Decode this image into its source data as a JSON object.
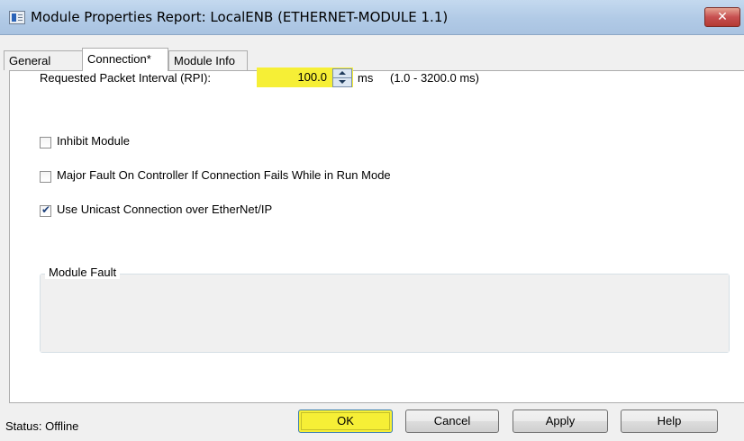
{
  "window": {
    "title": "Module Properties Report: LocalENB (ETHERNET-MODULE 1.1)",
    "close_glyph": "✕"
  },
  "tabs": [
    {
      "label": "General"
    },
    {
      "label": "Connection*",
      "active": true
    },
    {
      "label": "Module Info"
    }
  ],
  "connection": {
    "rpi_label": "Requested Packet Interval (RPI):",
    "rpi_value": "100.0",
    "rpi_unit": "ms",
    "rpi_range": "(1.0 - 3200.0 ms)",
    "highlight_color": "#f6ef36",
    "options": [
      {
        "label": "Inhibit Module",
        "checked": false
      },
      {
        "label": "Major Fault On Controller If Connection Fails While in Run Mode",
        "checked": false
      },
      {
        "label": "Use Unicast Connection over EtherNet/IP",
        "checked": true
      }
    ],
    "module_fault_title": "Module Fault",
    "module_fault_text": ""
  },
  "footer": {
    "status": "Status:  Offline",
    "buttons": {
      "ok": "OK",
      "cancel": "Cancel",
      "apply": "Apply",
      "help": "Help"
    }
  }
}
